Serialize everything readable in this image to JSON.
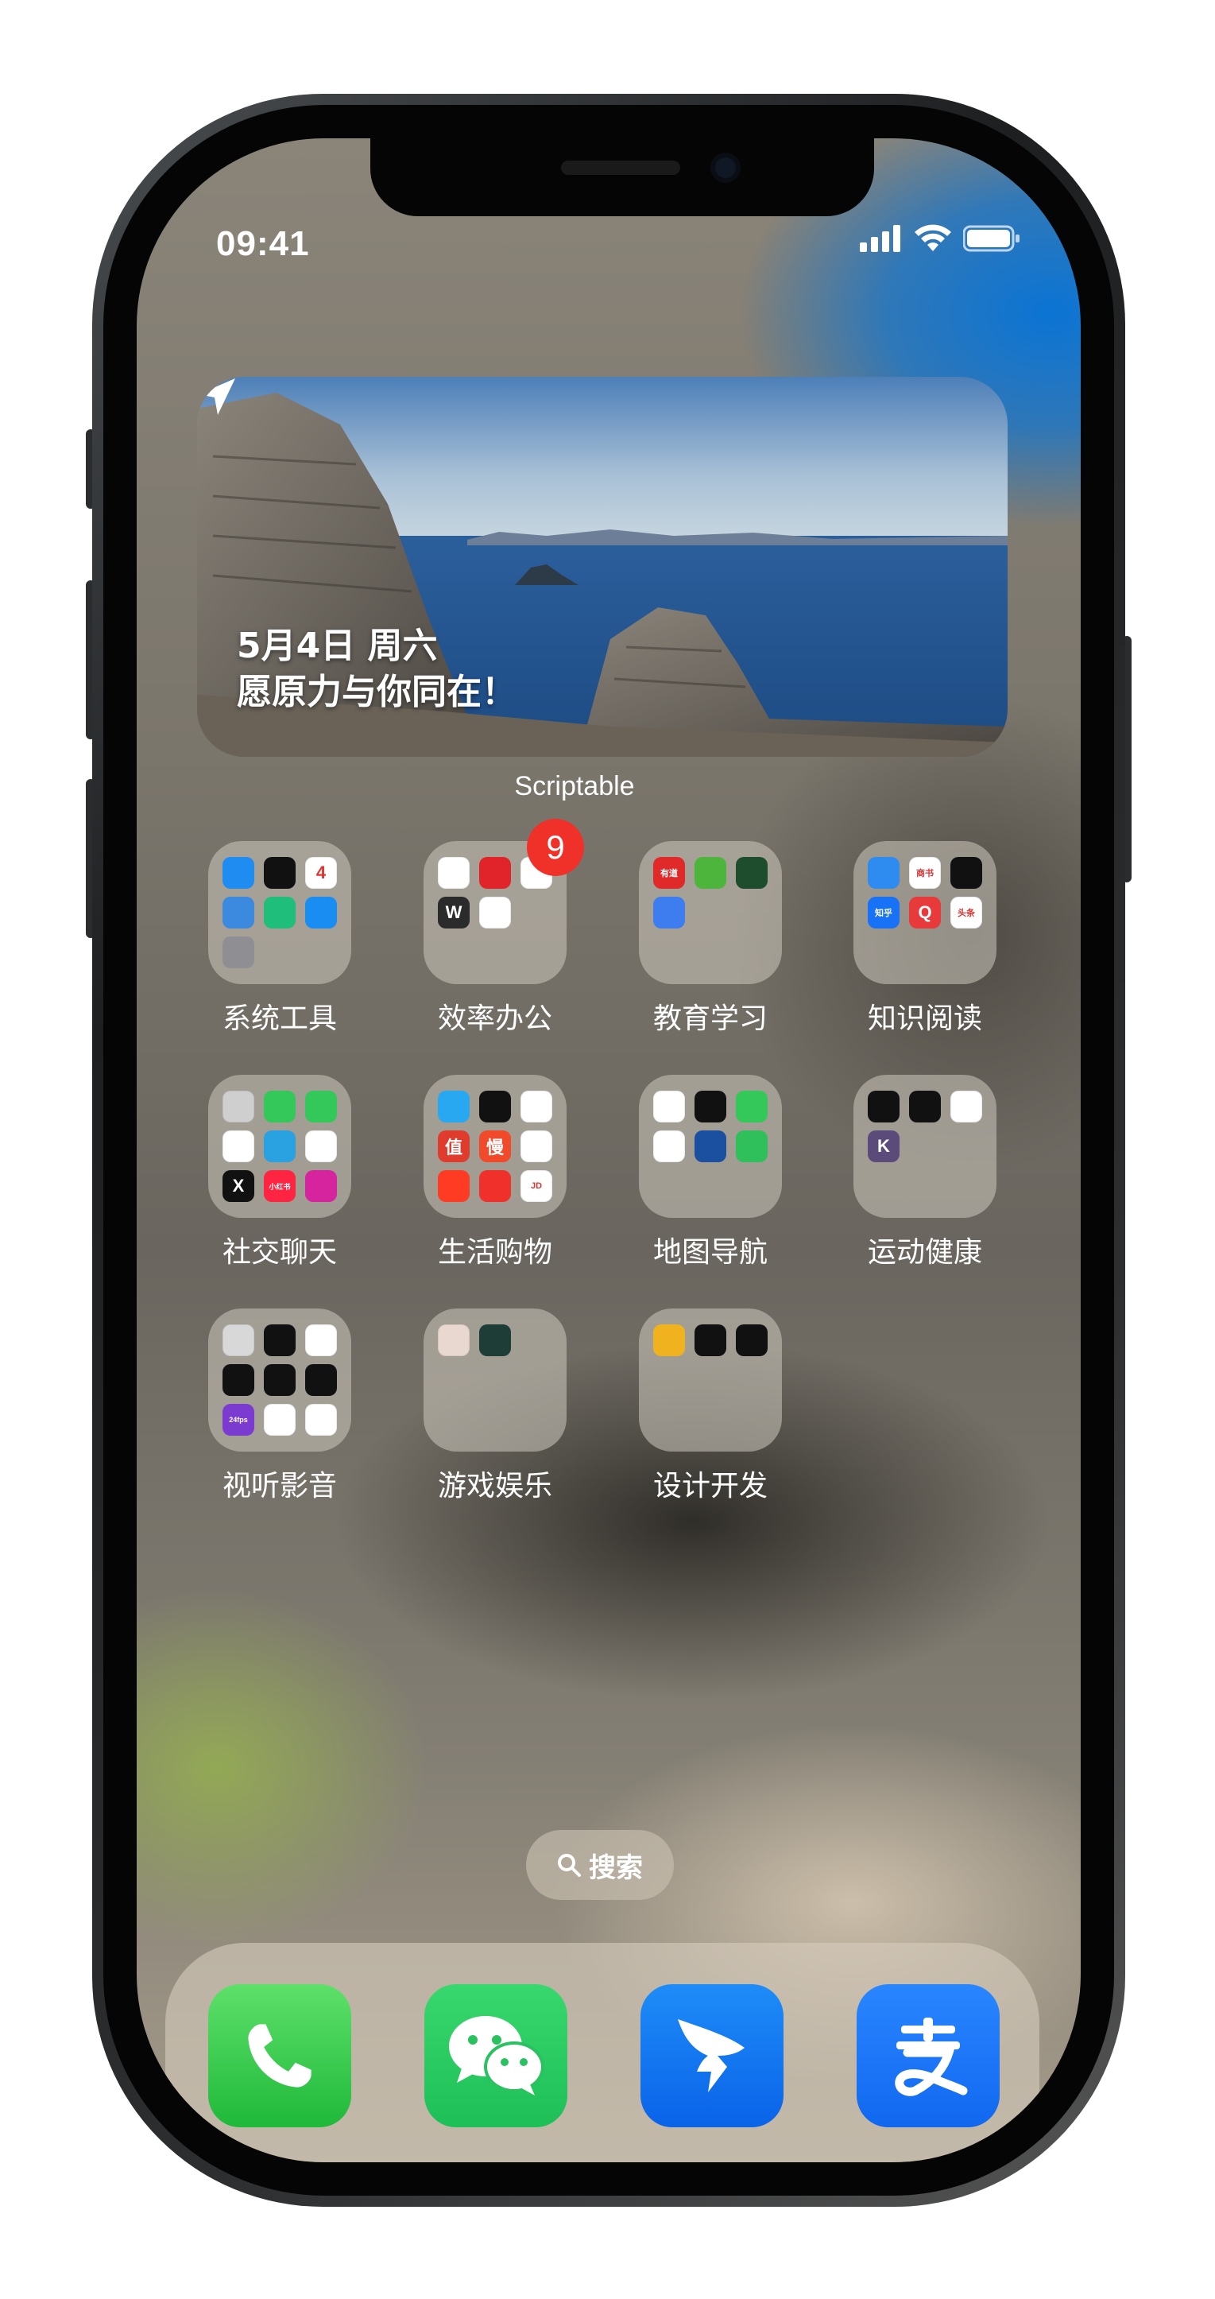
{
  "status_bar": {
    "time": "09:41",
    "icons": [
      "signal-icon",
      "wifi-icon",
      "battery-icon"
    ]
  },
  "widget": {
    "line1": "5月4日 周六",
    "line2": "愿原力与你同在！",
    "app_label": "Scriptable",
    "icon": "location-arrow-icon"
  },
  "folders": [
    {
      "label": "系统工具",
      "badge": "",
      "apps": [
        {
          "name": "safari-icon",
          "color": "#1e8cf0",
          "text": ""
        },
        {
          "name": "clock-icon",
          "color": "#111",
          "text": ""
        },
        {
          "name": "calendar-icon",
          "color": "#fff",
          "text": "4"
        },
        {
          "name": "weather-icon",
          "color": "#3b8ae0",
          "text": ""
        },
        {
          "name": "mi-home-icon",
          "color": "#1fbf7b",
          "text": ""
        },
        {
          "name": "app-store-icon",
          "color": "#1a8df2",
          "text": ""
        },
        {
          "name": "settings-icon",
          "color": "#8e8e93",
          "text": ""
        }
      ]
    },
    {
      "label": "效率办公",
      "badge": "9",
      "apps": [
        {
          "name": "ding-icon",
          "color": "#fff",
          "text": ""
        },
        {
          "name": "music-app-icon",
          "color": "#e0242a",
          "text": ""
        },
        {
          "name": "task-icon",
          "color": "#fff",
          "text": ""
        },
        {
          "name": "wps-icon",
          "color": "#2b2b2b",
          "text": "W"
        },
        {
          "name": "cloud-icon",
          "color": "#fff",
          "text": ""
        }
      ]
    },
    {
      "label": "教育学习",
      "badge": "",
      "apps": [
        {
          "name": "youdao-icon",
          "color": "#e02a2a",
          "text": "有道"
        },
        {
          "name": "duolingo-icon",
          "color": "#4db53c",
          "text": ""
        },
        {
          "name": "play-icon",
          "color": "#1d4d2c",
          "text": ""
        },
        {
          "name": "pen-icon",
          "color": "#3d7df0",
          "text": ""
        }
      ]
    },
    {
      "label": "知识阅读",
      "badge": "",
      "apps": [
        {
          "name": "reader-icon",
          "color": "#2e8cf0",
          "text": ""
        },
        {
          "name": "books-icon",
          "color": "#fff",
          "text": "商书"
        },
        {
          "name": "medium-icon",
          "color": "#111",
          "text": ""
        },
        {
          "name": "zhihu-icon",
          "color": "#1772f6",
          "text": "知乎"
        },
        {
          "name": "qq-browser-icon",
          "color": "#e83a3a",
          "text": "Q"
        },
        {
          "name": "toutiao-icon",
          "color": "#fff",
          "text": "头条"
        }
      ]
    },
    {
      "label": "社交聊天",
      "badge": "",
      "apps": [
        {
          "name": "contacts-icon",
          "color": "#cfcfcf",
          "text": ""
        },
        {
          "name": "messages-icon",
          "color": "#34c759",
          "text": ""
        },
        {
          "name": "facetime-icon",
          "color": "#34c759",
          "text": ""
        },
        {
          "name": "qq-icon",
          "color": "#fff",
          "text": ""
        },
        {
          "name": "telegram-icon",
          "color": "#2aa1e0",
          "text": ""
        },
        {
          "name": "weibo-icon",
          "color": "#fff",
          "text": ""
        },
        {
          "name": "x-icon",
          "color": "#111",
          "text": "X"
        },
        {
          "name": "xiaohongshu-icon",
          "color": "#ff2442",
          "text": "小红书"
        },
        {
          "name": "instagram-icon",
          "color": "#d6249f",
          "text": ""
        }
      ]
    },
    {
      "label": "生活购物",
      "badge": "",
      "apps": [
        {
          "name": "alipay-mini-icon",
          "color": "#29a8f2",
          "text": ""
        },
        {
          "name": "wallet-icon",
          "color": "#111",
          "text": ""
        },
        {
          "name": "shop-icon",
          "color": "#fff",
          "text": ""
        },
        {
          "name": "zhide-icon",
          "color": "#e03c2e",
          "text": "值"
        },
        {
          "name": "man-icon",
          "color": "#f04a2a",
          "text": "慢"
        },
        {
          "name": "link-icon",
          "color": "#fff",
          "text": ""
        },
        {
          "name": "taobao-icon",
          "color": "#ff3b24",
          "text": ""
        },
        {
          "name": "pdd-icon",
          "color": "#f0302a",
          "text": ""
        },
        {
          "name": "jd-icon",
          "color": "#fff",
          "text": "JD"
        }
      ]
    },
    {
      "label": "地图导航",
      "badge": "",
      "apps": [
        {
          "name": "maps-icon",
          "color": "#fff",
          "text": ""
        },
        {
          "name": "compass-icon",
          "color": "#111",
          "text": ""
        },
        {
          "name": "find-my-icon",
          "color": "#34c759",
          "text": ""
        },
        {
          "name": "didi-icon",
          "color": "#fff",
          "text": ""
        },
        {
          "name": "metro-icon",
          "color": "#1b4fa0",
          "text": ""
        },
        {
          "name": "amap-icon",
          "color": "#2fbf5b",
          "text": ""
        }
      ]
    },
    {
      "label": "运动健康",
      "badge": "",
      "apps": [
        {
          "name": "watch-icon",
          "color": "#111",
          "text": ""
        },
        {
          "name": "fitness-icon",
          "color": "#111",
          "text": ""
        },
        {
          "name": "health-icon",
          "color": "#fff",
          "text": ""
        },
        {
          "name": "keep-icon",
          "color": "#5a4b7a",
          "text": "K"
        }
      ]
    },
    {
      "label": "视听影音",
      "badge": "",
      "apps": [
        {
          "name": "camera-icon",
          "color": "#d8d8d8",
          "text": ""
        },
        {
          "name": "lens-icon",
          "color": "#111",
          "text": ""
        },
        {
          "name": "photos-icon",
          "color": "#fff",
          "text": ""
        },
        {
          "name": "green-dot-icon",
          "color": "#111",
          "text": ""
        },
        {
          "name": "circle-icon",
          "color": "#111",
          "text": ""
        },
        {
          "name": "capcut-icon",
          "color": "#111",
          "text": ""
        },
        {
          "name": "24fps-icon",
          "color": "#7b3bd0",
          "text": "24fps"
        },
        {
          "name": "wave-icon",
          "color": "#fff",
          "text": ""
        },
        {
          "name": "frame-icon",
          "color": "#fff",
          "text": ""
        }
      ]
    },
    {
      "label": "游戏娱乐",
      "badge": "",
      "apps": [
        {
          "name": "anime-game-icon",
          "color": "#e8d8d0",
          "text": ""
        },
        {
          "name": "rpg-game-icon",
          "color": "#1d3d36",
          "text": ""
        }
      ]
    },
    {
      "label": "设计开发",
      "badge": "",
      "apps": [
        {
          "name": "cube-icon",
          "color": "#f0b21e",
          "text": ""
        },
        {
          "name": "flow-icon",
          "color": "#111",
          "text": ""
        },
        {
          "name": "gemini-icon",
          "color": "#111",
          "text": ""
        }
      ]
    }
  ],
  "search": {
    "label": "搜索",
    "icon": "search-icon"
  },
  "dock": [
    {
      "name": "phone-app",
      "icon": "phone-icon",
      "color": "#34c759"
    },
    {
      "name": "wechat-app",
      "icon": "wechat-icon",
      "color": "#2ac161"
    },
    {
      "name": "dingtalk-app",
      "icon": "dingtalk-icon",
      "color": "#1a7cf5"
    },
    {
      "name": "alipay-app",
      "icon": "alipay-icon",
      "color": "#1677ff",
      "text": "支"
    }
  ]
}
